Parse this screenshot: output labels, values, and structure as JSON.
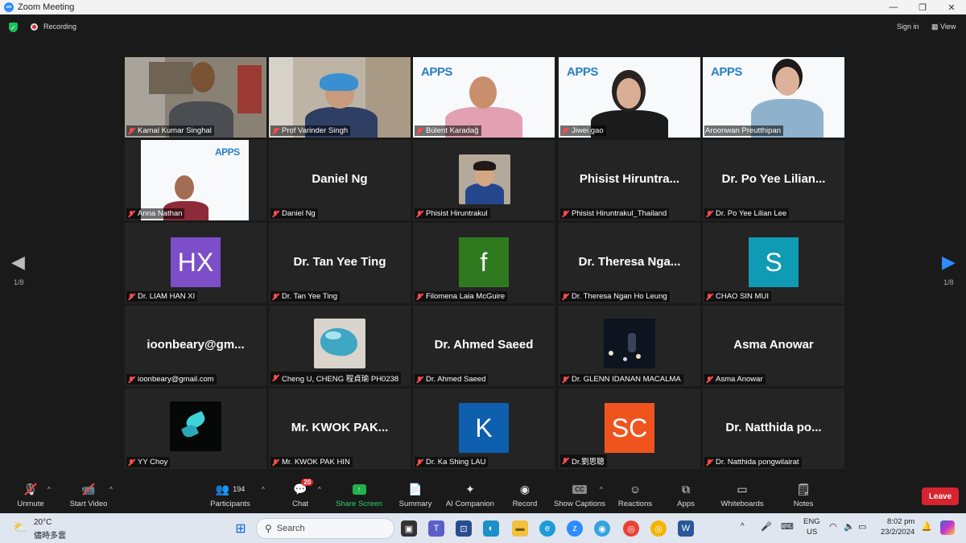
{
  "window": {
    "title": "Zoom Meeting",
    "controls": {
      "minimize": "—",
      "restore": "❐",
      "close": "✕"
    }
  },
  "topbar": {
    "recording_label": "Recording",
    "signin_label": "Sign in",
    "view_label": "View"
  },
  "gallery": {
    "page_indicator_left": "1/8",
    "page_indicator_right": "1/8",
    "tiles": [
      {
        "display": "Kamal Kumar Singhal",
        "type": "video"
      },
      {
        "display": "Prof Varinder Singh",
        "type": "video"
      },
      {
        "display": "Bülent Karadağ",
        "type": "video"
      },
      {
        "display": "Jiwei gao",
        "type": "video"
      },
      {
        "display": "Aroonwan Preutthipan",
        "type": "video",
        "active": true
      },
      {
        "display": "Anna Nathan",
        "type": "video"
      },
      {
        "display": "Daniel Ng",
        "type": "name",
        "big": "Daniel Ng"
      },
      {
        "display": "Phisist Hiruntrakul",
        "type": "photo"
      },
      {
        "display": "Phisist Hiruntrakul_Thailand",
        "type": "name",
        "big": "Phisist Hiruntra..."
      },
      {
        "display": "Dr. Po Yee Lilian Lee",
        "type": "name",
        "big": "Dr. Po Yee Lilian..."
      },
      {
        "display": "Dr. LIAM HAN XI",
        "type": "avatar",
        "initials": "HX",
        "color": "#7c4fc8"
      },
      {
        "display": "Dr. Tan Yee Ting",
        "type": "name",
        "big": "Dr. Tan Yee Ting"
      },
      {
        "display": "Filomena Laia McGuire",
        "type": "avatar",
        "initials": "f",
        "color": "#2f7a1f"
      },
      {
        "display": "Dr. Theresa Ngan Ho Leung",
        "type": "name",
        "big": "Dr. Theresa Nga..."
      },
      {
        "display": "CHAO SIN MUI",
        "type": "avatar",
        "initials": "S",
        "color": "#0f9bb4"
      },
      {
        "display": "ioonbeary@gmail.com",
        "type": "name",
        "big": "ioonbeary@gm..."
      },
      {
        "display": "Cheng U, CHENG 程貞瑜 PH0238",
        "type": "photo"
      },
      {
        "display": "Dr. Ahmed Saeed",
        "type": "name",
        "big": "Dr. Ahmed Saeed"
      },
      {
        "display": "Dr. GLENN IDANAN MACALMA",
        "type": "photo"
      },
      {
        "display": "Asma Anowar",
        "type": "name",
        "big": "Asma Anowar"
      },
      {
        "display": "YY Choy",
        "type": "photo"
      },
      {
        "display": "Mr. KWOK PAK HIN",
        "type": "name",
        "big": "Mr. KWOK PAK..."
      },
      {
        "display": "Dr. Ka Shing LAU",
        "type": "avatar",
        "initials": "K",
        "color": "#0e5fae"
      },
      {
        "display": "Dr.劉思聰",
        "type": "avatar",
        "initials": "SC",
        "color": "#f0541e"
      },
      {
        "display": "Dr. Natthida pongwilairat",
        "type": "name",
        "big": "Dr. Natthida po..."
      }
    ],
    "apps_logo_text": "APPS"
  },
  "toolbar": {
    "unmute": "Unmute",
    "start_video": "Start Video",
    "participants": "Participants",
    "participants_count": "194",
    "chat": "Chat",
    "chat_badge": "20",
    "share_screen": "Share Screen",
    "summary": "Summary",
    "ai_companion": "AI Companion",
    "record": "Record",
    "show_captions": "Show Captions",
    "reactions": "Reactions",
    "apps": "Apps",
    "whiteboards": "Whiteboards",
    "notes": "Notes",
    "leave": "Leave",
    "captions_icon_text": "CC"
  },
  "taskbar": {
    "weather_temp": "20°C",
    "weather_desc": "儘時多雲",
    "search_placeholder": "Search",
    "lang_top": "ENG",
    "lang_bottom": "US",
    "time": "8:02 pm",
    "date": "23/2/2024"
  }
}
